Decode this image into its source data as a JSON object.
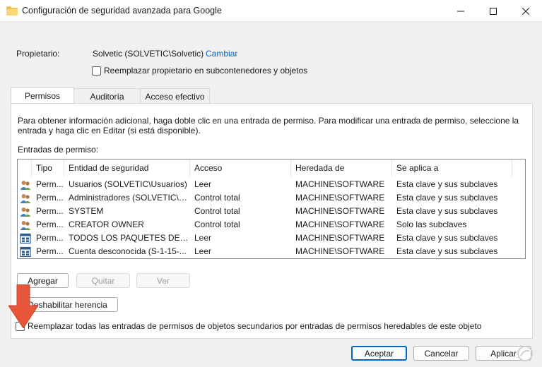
{
  "window": {
    "title": "Configuración de seguridad avanzada para Google",
    "icon": "folder-icon",
    "controls": [
      "minimize-icon",
      "maximize-icon",
      "close-icon"
    ]
  },
  "owner": {
    "label": "Propietario:",
    "value": "Solvetic (SOLVETIC\\Solvetic)",
    "change_link": "Cambiar",
    "replace_checkbox_label": "Reemplazar propietario en subcontenedores y objetos",
    "replace_checked": false
  },
  "tabs": [
    {
      "label": "Permisos",
      "active": true
    },
    {
      "label": "Auditoría",
      "active": false
    },
    {
      "label": "Acceso efectivo",
      "active": false
    }
  ],
  "permissions": {
    "info_text": "Para obtener información adicional, haga doble clic en una entrada de permiso. Para modificar una entrada de permiso, seleccione la entrada y haga clic en Editar (si está disponible).",
    "entries_label": "Entradas de permiso:",
    "columns": [
      "Tipo",
      "Entidad de seguridad",
      "Acceso",
      "Heredada de",
      "Se aplica a"
    ],
    "rows": [
      {
        "icon": "users-icon",
        "tipo": "Perm...",
        "entidad": "Usuarios (SOLVETIC\\Usuarios)",
        "acceso": "Leer",
        "heredada": "MACHINE\\SOFTWARE",
        "aplica": "Esta clave y sus subclaves"
      },
      {
        "icon": "users-icon",
        "tipo": "Perm...",
        "entidad": "Administradores (SOLVETIC\\A...",
        "acceso": "Control total",
        "heredada": "MACHINE\\SOFTWARE",
        "aplica": "Esta clave y sus subclaves"
      },
      {
        "icon": "users-icon",
        "tipo": "Perm...",
        "entidad": "SYSTEM",
        "acceso": "Control total",
        "heredada": "MACHINE\\SOFTWARE",
        "aplica": "Esta clave y sus subclaves"
      },
      {
        "icon": "users-icon",
        "tipo": "Perm...",
        "entidad": "CREATOR OWNER",
        "acceso": "Control total",
        "heredada": "MACHINE\\SOFTWARE",
        "aplica": "Solo las subclaves"
      },
      {
        "icon": "app-package-icon",
        "tipo": "Perm...",
        "entidad": "TODOS LOS PAQUETES DE AP...",
        "acceso": "Leer",
        "heredada": "MACHINE\\SOFTWARE",
        "aplica": "Esta clave y sus subclaves"
      },
      {
        "icon": "app-package-icon",
        "tipo": "Perm...",
        "entidad": "Cuenta desconocida (S-1-15-...",
        "acceso": "Leer",
        "heredada": "MACHINE\\SOFTWARE",
        "aplica": "Esta clave y sus subclaves"
      }
    ],
    "buttons": {
      "add": "Agregar",
      "remove": "Quitar",
      "view": "Ver"
    },
    "disable_inheritance": "Deshabilitar herencia",
    "replace_all_label": "Reemplazar todas las entradas de permisos de objetos secundarios por entradas de permisos heredables de este objeto",
    "replace_all_checked": false
  },
  "footer": {
    "ok": "Aceptar",
    "cancel": "Cancelar",
    "apply": "Aplicar"
  },
  "colors": {
    "accent": "#0067c0",
    "arrow": "#e8563a"
  }
}
